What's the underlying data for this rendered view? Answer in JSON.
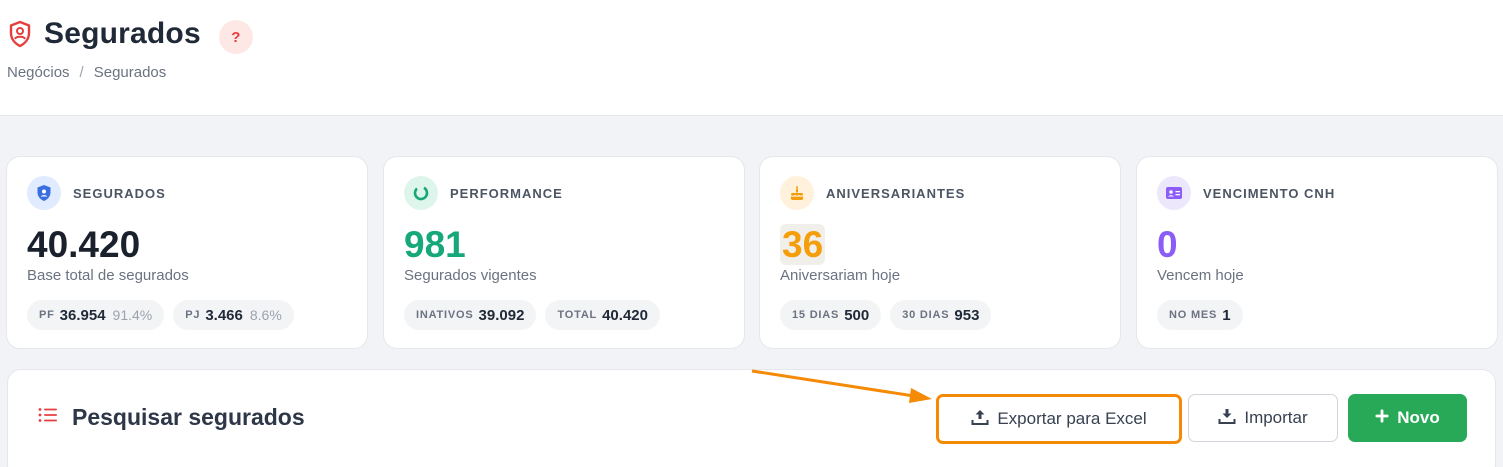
{
  "header": {
    "title": "Segurados",
    "help_label": "?",
    "breadcrumb": [
      "Negócios",
      "/",
      "Segurados"
    ]
  },
  "cards": [
    {
      "label": "SEGURADOS",
      "value": "40.420",
      "subtitle": "Base total de segurados",
      "icon": "shield-user-icon",
      "color": "#1a202c",
      "chips": [
        {
          "label": "PF",
          "value": "36.954",
          "pct": "91.4%"
        },
        {
          "label": "PJ",
          "value": "3.466",
          "pct": "8.6%"
        }
      ]
    },
    {
      "label": "PERFORMANCE",
      "value": "981",
      "subtitle": "Segurados vigentes",
      "icon": "progress-ring-icon",
      "color": "#16a77a",
      "chips": [
        {
          "label": "INATIVOS",
          "value": "39.092"
        },
        {
          "label": "TOTAL",
          "value": "40.420"
        }
      ]
    },
    {
      "label": "ANIVERSARIANTES",
      "value": "36",
      "subtitle": "Aniversariam hoje",
      "icon": "cake-icon",
      "color": "#f59e0b",
      "chips": [
        {
          "label": "15 DIAS",
          "value": "500"
        },
        {
          "label": "30 DIAS",
          "value": "953"
        }
      ]
    },
    {
      "label": "VENCIMENTO CNH",
      "value": "0",
      "subtitle": "Vencem hoje",
      "icon": "id-card-icon",
      "color": "#8b5cf6",
      "chips": [
        {
          "label": "NO MES",
          "value": "1"
        }
      ]
    }
  ],
  "search": {
    "title": "Pesquisar segurados",
    "export_label": "Exportar para Excel",
    "import_label": "Importar",
    "new_label": "Novo"
  },
  "colors": {
    "accent_red": "#e53e3e",
    "highlight_orange": "#f58a07",
    "new_green": "#28a957"
  }
}
